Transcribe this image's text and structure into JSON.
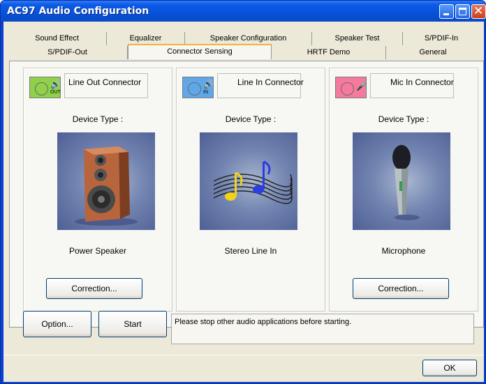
{
  "window": {
    "title": "AC97 Audio Configuration"
  },
  "tabs": {
    "row1": [
      "Sound Effect",
      "Equalizer",
      "Speaker Configuration",
      "Speaker Test",
      "S/PDIF-In"
    ],
    "row2": [
      "S/PDIF-Out",
      "Connector Sensing",
      "HRTF Demo",
      "General"
    ],
    "active": "Connector Sensing"
  },
  "panels": [
    {
      "connector_label": "Line Out Connector",
      "icon_sub": "OUT",
      "icon_color": "#8fd14a",
      "device_type_label": "Device Type :",
      "device_name": "Power Speaker",
      "button": "Correction..."
    },
    {
      "connector_label": "Line In Connector",
      "icon_sub": "IN",
      "icon_color": "#5fa7e8",
      "device_type_label": "Device Type :",
      "device_name": "Stereo Line In"
    },
    {
      "connector_label": "Mic In Connector",
      "icon_sub": "",
      "icon_color": "#f57a9e",
      "device_type_label": "Device Type :",
      "device_name": "Microphone",
      "button": "Correction..."
    }
  ],
  "actions": {
    "option": "Option...",
    "start": "Start",
    "ok": "OK"
  },
  "status_message": "Please stop other audio applications before starting.",
  "colors": {
    "titlebar": "#0752d8",
    "client_bg": "#ece9d8",
    "active_tab_accent": "#f5b13c"
  }
}
